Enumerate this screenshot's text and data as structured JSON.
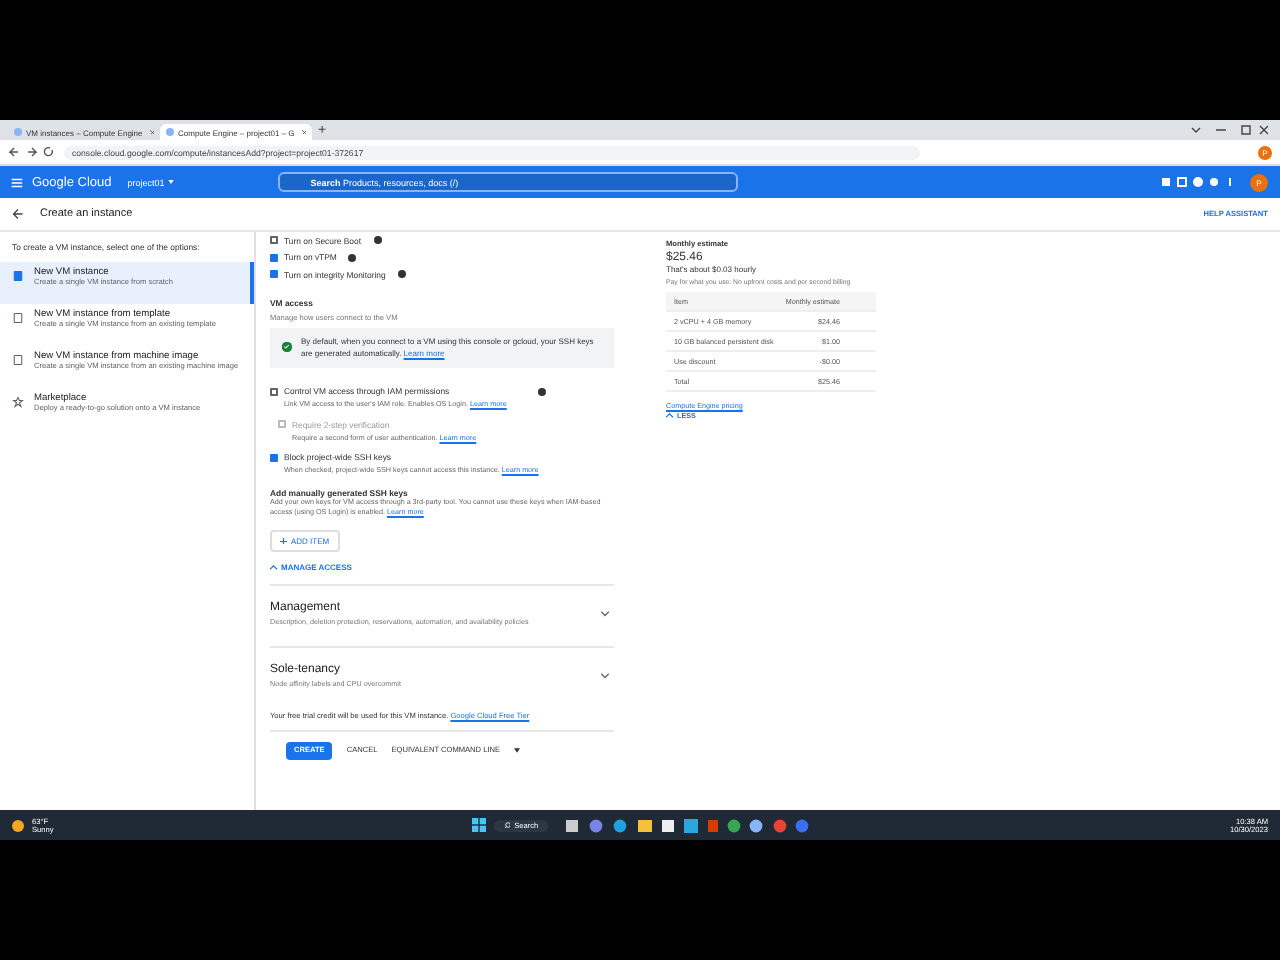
{
  "browser": {
    "tabs": [
      {
        "title": "VM instances – Compute Engine",
        "selected": false
      },
      {
        "title": "Compute Engine – project01 – G",
        "selected": true
      }
    ],
    "new_tab": "+",
    "url": "console.cloud.google.com/compute/instancesAdd?project=project01-372617",
    "avatar": "P"
  },
  "header": {
    "brand": "Google Cloud",
    "project": "project01",
    "search_label": "Search",
    "search_placeholder": "Products, resources, docs (/)",
    "avatar": "P"
  },
  "page": {
    "title": "Create an instance",
    "help": "HELP ASSISTANT"
  },
  "options": {
    "intro": "To create a VM instance, select one of the options:",
    "items": [
      {
        "kind": "vm",
        "title": "New VM instance",
        "desc": "Create a single VM instance from scratch",
        "selected": true
      },
      {
        "kind": "template",
        "title": "New VM instance from template",
        "desc": "Create a single VM instance from an existing template",
        "selected": false
      },
      {
        "kind": "image",
        "title": "New VM instance from machine image",
        "desc": "Create a single VM instance from an existing machine image",
        "selected": false
      },
      {
        "kind": "market",
        "title": "Marketplace",
        "desc": "Deploy a ready-to-go solution onto a VM instance",
        "selected": false
      }
    ]
  },
  "shielded": [
    {
      "label": "Turn on Secure Boot",
      "checked": false
    },
    {
      "label": "Turn on vTPM",
      "checked": true
    },
    {
      "label": "Turn on integrity Monitoring",
      "checked": true
    }
  ],
  "vm_access": {
    "title": "VM access",
    "desc": "Manage how users connect to the VM",
    "info": "By default, when you connect to a VM using this console or gcloud, your SSH keys are generated automatically.",
    "info_link": "Learn more",
    "options": [
      {
        "label": "Control VM access through IAM permissions",
        "desc": "Link VM access to the user's IAM role. Enables OS Login.",
        "link": "Learn more",
        "checked": false,
        "disabled": false,
        "help": true,
        "children": [
          {
            "label": "Require 2-step verification",
            "desc": "Require a second form of user authentication.",
            "link": "Learn more",
            "checked": false,
            "disabled": true,
            "help": false
          }
        ]
      },
      {
        "label": "Block project-wide SSH keys",
        "desc": "When checked, project-wide SSH keys cannot access this instance.",
        "link": "Learn more",
        "checked": true,
        "disabled": false,
        "help": false
      }
    ],
    "ssh_title": "Add manually generated SSH keys",
    "ssh_desc": "Add your own keys for VM access through a 3rd-party tool. You cannot use these keys when IAM-based access (using OS Login) is enabled.",
    "ssh_link": "Learn more",
    "add_item": "ADD ITEM",
    "manage": "MANAGE ACCESS"
  },
  "sections": [
    {
      "title": "Management",
      "desc": "Description, deletion protection, reservations, automation, and availability policies",
      "expanded": false
    },
    {
      "title": "Sole-tenancy",
      "desc": "Node affinity labels and CPU overcommit",
      "expanded": false
    }
  ],
  "free_trial": "Your free trial credit will be used for this VM instance.",
  "free_trial_link": "Google Cloud Free Tier",
  "actions": {
    "create": "CREATE",
    "cancel": "CANCEL",
    "command": "EQUIVALENT COMMAND LINE"
  },
  "estimate": {
    "title": "Monthly estimate",
    "total": "$25.46",
    "hourly": "That's about $0.03 hourly",
    "note": "Pay for what you use: No upfront costs and per second billing",
    "columns": [
      "Item",
      "Monthly estimate"
    ],
    "rows": [
      [
        "2 vCPU + 4 GB memory",
        "$24.46"
      ],
      [
        "10 GB balanced persistent disk",
        "$1.00"
      ],
      [
        "Use discount",
        "-$0.00"
      ],
      [
        "Total",
        "$25.46"
      ]
    ],
    "pricing_link": "Compute Engine pricing",
    "less": "LESS"
  },
  "taskbar": {
    "temp": "63°F",
    "weather": "Sunny",
    "search": "Search",
    "time": "10:38 AM",
    "date": "10/30/2023"
  }
}
